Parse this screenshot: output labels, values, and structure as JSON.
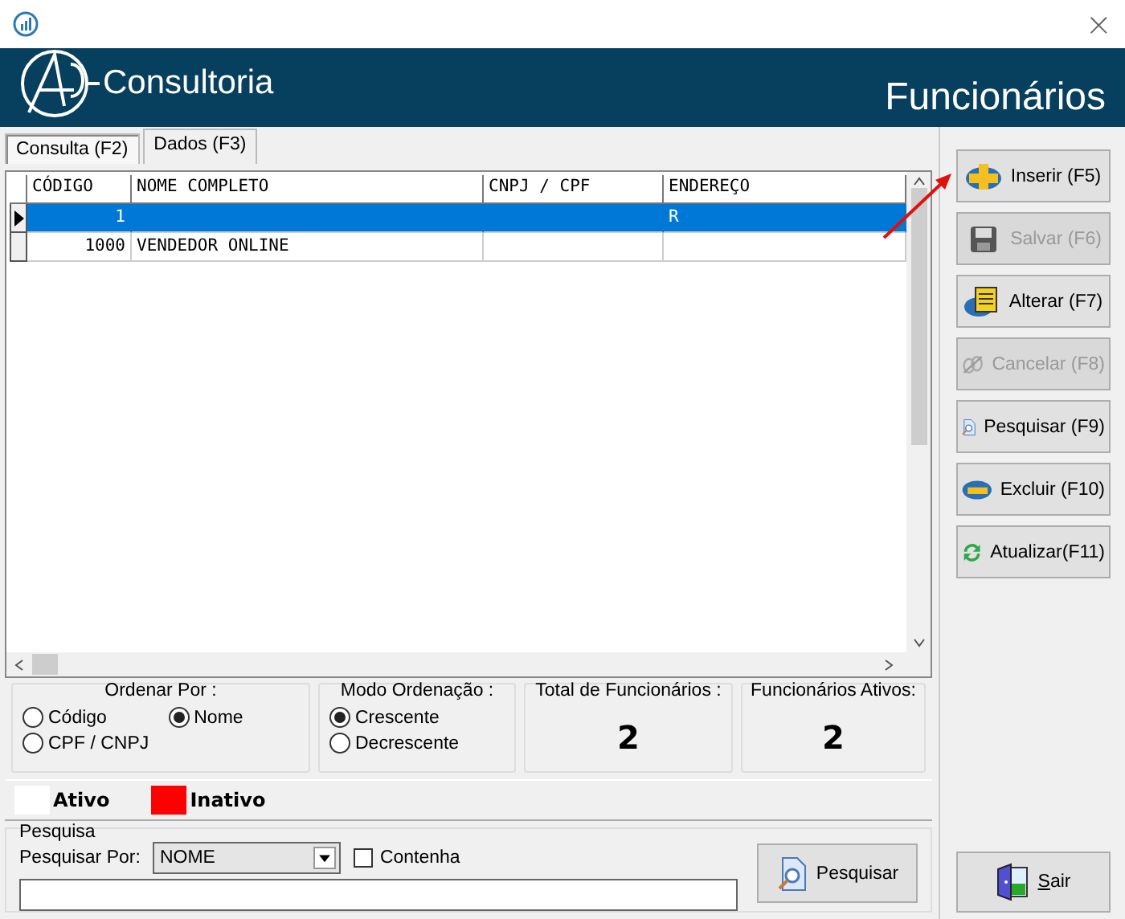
{
  "window": {
    "close": "×"
  },
  "header": {
    "brand": "Consultoria",
    "title": "Funcionários"
  },
  "tabs": [
    {
      "label": "Consulta (F2)",
      "selected": true
    },
    {
      "label": "Dados (F3)",
      "selected": false
    }
  ],
  "table": {
    "columns": [
      "CÓDIGO",
      "NOME COMPLETO",
      "CNPJ / CPF",
      "ENDEREÇO"
    ],
    "rows": [
      {
        "cells": [
          "1",
          "",
          "",
          "R"
        ],
        "selected": true
      },
      {
        "cells": [
          "1000",
          "VENDEDOR ONLINE",
          "",
          ""
        ],
        "selected": false
      }
    ]
  },
  "order_by": {
    "title": "Ordenar Por :",
    "options": [
      {
        "label": "Código",
        "selected": false
      },
      {
        "label": "Nome",
        "selected": true
      },
      {
        "label": "CPF / CNPJ",
        "selected": false
      }
    ]
  },
  "order_mode": {
    "title": "Modo Ordenação :",
    "options": [
      {
        "label": "Crescente",
        "selected": true
      },
      {
        "label": "Decrescente",
        "selected": false
      }
    ]
  },
  "stats": [
    {
      "title": "Total de Funcionários :",
      "value": "2"
    },
    {
      "title": "Funcionários Ativos:",
      "value": "2"
    }
  ],
  "legend": [
    {
      "label": "Ativo",
      "color": "#ffffff"
    },
    {
      "label": "Inativo",
      "color": "#ff0000"
    }
  ],
  "search": {
    "title": "Pesquisa",
    "by_label": "Pesquisar Por:",
    "by_value": "NOME",
    "contains_label": "Contenha",
    "contains_checked": false,
    "button": "Pesquisar"
  },
  "actions": [
    {
      "label": "Inserir (F5)",
      "kind": "insert",
      "disabled": false
    },
    {
      "label": "Salvar (F6)",
      "kind": "save",
      "disabled": true
    },
    {
      "label": "Alterar (F7)",
      "kind": "edit",
      "disabled": false
    },
    {
      "label": "Cancelar (F8)",
      "kind": "cancel",
      "disabled": true
    },
    {
      "label": "Pesquisar (F9)",
      "kind": "search",
      "disabled": false
    },
    {
      "label": "Excluir (F10)",
      "kind": "delete",
      "disabled": false
    },
    {
      "label": "Atualizar(F11)",
      "kind": "refresh",
      "disabled": false
    }
  ],
  "exit_button": "Sair"
}
